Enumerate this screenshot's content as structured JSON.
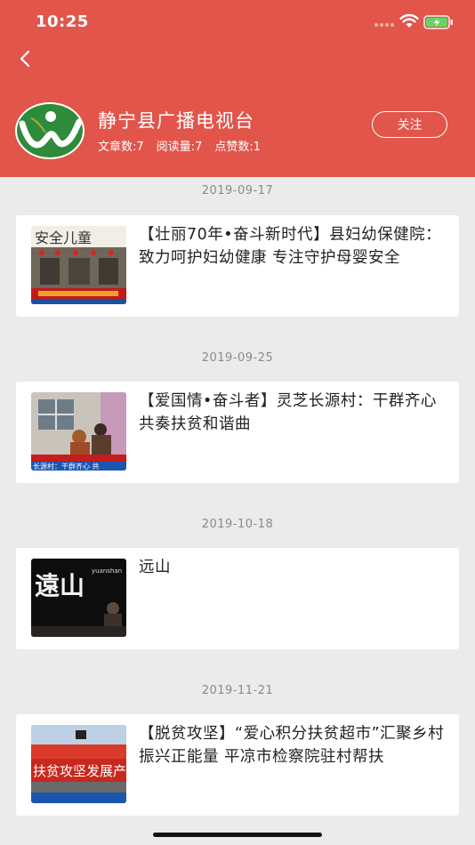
{
  "status_bar": {
    "time": "10:25"
  },
  "header": {
    "channel_name": "静宁县广播电视台",
    "stats": {
      "articles": "文章数:7",
      "reads": "阅读量:7",
      "likes": "点赞数:1"
    },
    "follow_label": "关注"
  },
  "feed": [
    {
      "date": "2019-09-17",
      "title": "【壮丽70年•奋斗新时代】县妇幼保健院：致力呵护妇幼健康 专注守护母婴安全"
    },
    {
      "date": "2019-09-25",
      "title": "【爱国情•奋斗者】灵芝长源村：干群齐心 共奏扶贫和谐曲"
    },
    {
      "date": "2019-10-18",
      "title": "远山"
    },
    {
      "date": "2019-11-21",
      "title": "【脱贫攻坚】“爱心积分扶贫超市”汇聚乡村振兴正能量 平凉市检察院驻村帮扶"
    }
  ],
  "thumbnails": {
    "t1_banner": "安全儿童",
    "t2_caption": "长源村：干群齐心 共",
    "t3_word": "遠山",
    "t3_sub": "yuanshan",
    "t4_banner": "扶贫攻坚发展产业"
  },
  "colors": {
    "brand": "#e1554b",
    "background": "#ebebeb",
    "date_text": "#8a8a8a"
  }
}
